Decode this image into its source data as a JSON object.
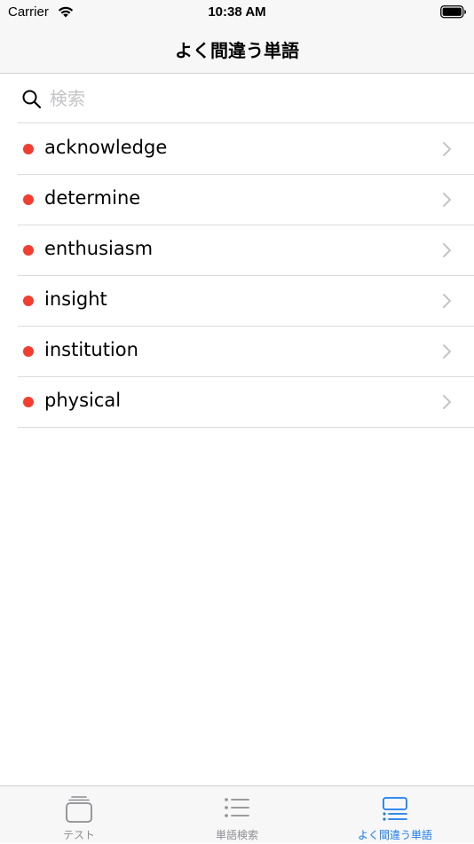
{
  "status_bar": {
    "carrier": "Carrier",
    "time": "10:38 AM",
    "wifi_icon": "wifi-icon",
    "battery_icon": "battery-icon"
  },
  "nav": {
    "title": "よく間違う単語"
  },
  "search": {
    "placeholder": "検索",
    "value": "",
    "icon": "search-icon"
  },
  "words": [
    {
      "label": "acknowledge"
    },
    {
      "label": "determine"
    },
    {
      "label": "enthusiasm"
    },
    {
      "label": "insight"
    },
    {
      "label": "institution"
    },
    {
      "label": "physical"
    }
  ],
  "tabs": [
    {
      "label": "テスト",
      "icon": "cards-icon",
      "active": false
    },
    {
      "label": "単語検索",
      "icon": "list-icon",
      "active": false
    },
    {
      "label": "よく間違う単語",
      "icon": "bookmark-list-icon",
      "active": true
    }
  ],
  "colors": {
    "accent": "#1a7cf0",
    "dot": "#f23d30",
    "inactive_tab": "#8e8e93",
    "bar_background": "#f7f7f7"
  }
}
